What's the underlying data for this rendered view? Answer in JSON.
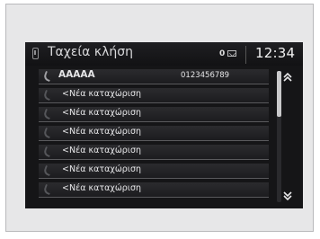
{
  "header": {
    "title": "Ταχεία κλήση",
    "message_count": "0",
    "clock": "12:34"
  },
  "icons": {
    "phone": "phone-icon",
    "message": "message-icon",
    "scroll_up": "chevron-up-icon",
    "scroll_down": "chevron-down-icon"
  },
  "list": {
    "rows": [
      {
        "name": "AAAAA",
        "number": "0123456789"
      },
      {
        "name": "<Νέα καταχώριση",
        "number": ""
      },
      {
        "name": "<Νέα καταχώριση",
        "number": ""
      },
      {
        "name": "<Νέα καταχώριση",
        "number": ""
      },
      {
        "name": "<Νέα καταχώριση",
        "number": ""
      },
      {
        "name": "<Νέα καταχώριση",
        "number": ""
      },
      {
        "name": "<Νέα καταχώριση",
        "number": ""
      }
    ]
  },
  "scrollbar": {
    "position_fraction": 0.0,
    "visible_fraction": 0.35
  }
}
